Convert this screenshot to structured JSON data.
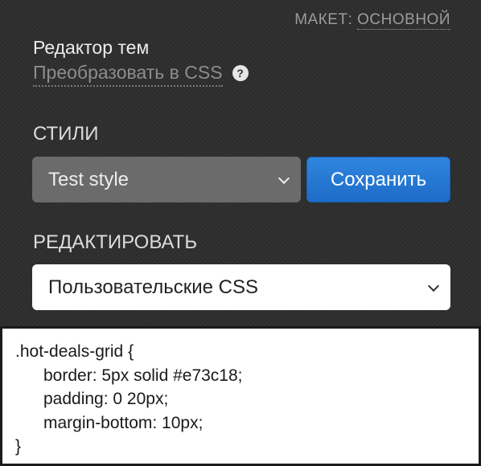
{
  "layout": {
    "label": "МАКЕТ:",
    "value": "ОСНОВНОЙ"
  },
  "editor": {
    "title": "Редактор тем",
    "convert_link": "Преобразовать в CSS",
    "help_icon": "?"
  },
  "styles": {
    "label": "СТИЛИ",
    "selected": "Test style",
    "save_label": "Сохранить"
  },
  "edit": {
    "label": "РЕДАКТИРОВАТЬ",
    "selected": "Пользовательские CSS"
  },
  "code": {
    "lines": [
      ".hot-deals-grid {",
      "border: 5px solid #e73c18;",
      "padding: 0 20px;",
      "margin-bottom: 10px;",
      "}"
    ]
  },
  "colors": {
    "background": "#2f2f2f",
    "accent": "#2f86df",
    "select_dark": "#6b6b6b"
  },
  "icons": [
    "help-icon",
    "chevron-down-icon"
  ]
}
